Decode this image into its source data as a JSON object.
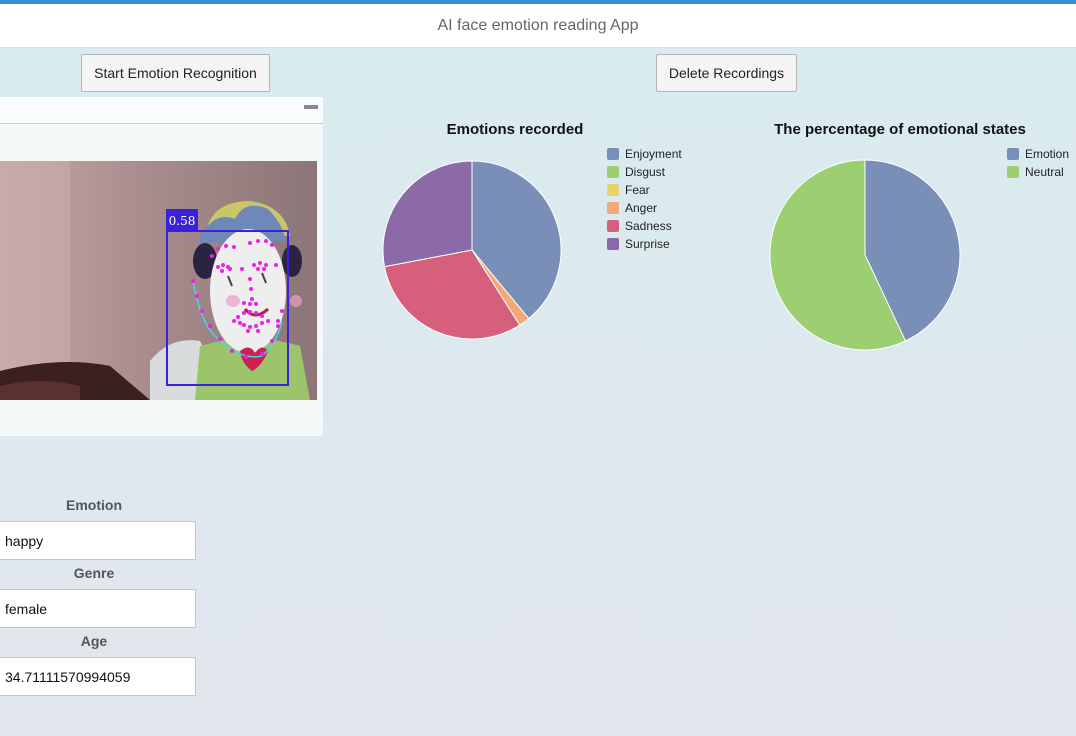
{
  "header": {
    "title": "AI face emotion reading App"
  },
  "toolbar": {
    "start_label": "Start Emotion Recognition",
    "delete_label": "Delete Recordings"
  },
  "video": {
    "confidence": "0.58"
  },
  "fields": {
    "emotion_label": "Emotion",
    "emotion_value": "happy",
    "genre_label": "Genre",
    "genre_value": "female",
    "age_label": "Age",
    "age_value": "34.71111570994059"
  },
  "colors": {
    "accent": "#3a8dd0",
    "enjoyment": "#7a8fb8",
    "disgust": "#9bcf72",
    "fear": "#e8d36a",
    "anger": "#f2a877",
    "sadness": "#d65f7c",
    "surprise": "#8c6aa8"
  },
  "chart_data": [
    {
      "type": "pie",
      "title": "Emotions recorded",
      "categories": [
        "Enjoyment",
        "Disgust",
        "Fear",
        "Anger",
        "Sadness",
        "Surprise"
      ],
      "values": [
        39,
        0,
        0,
        2,
        31,
        28
      ],
      "legend": "top-right"
    },
    {
      "type": "pie",
      "title": "The percentage of emotional states",
      "categories": [
        "Emotion",
        "Neutral"
      ],
      "values": [
        43,
        57
      ],
      "legend": "top-right"
    }
  ]
}
